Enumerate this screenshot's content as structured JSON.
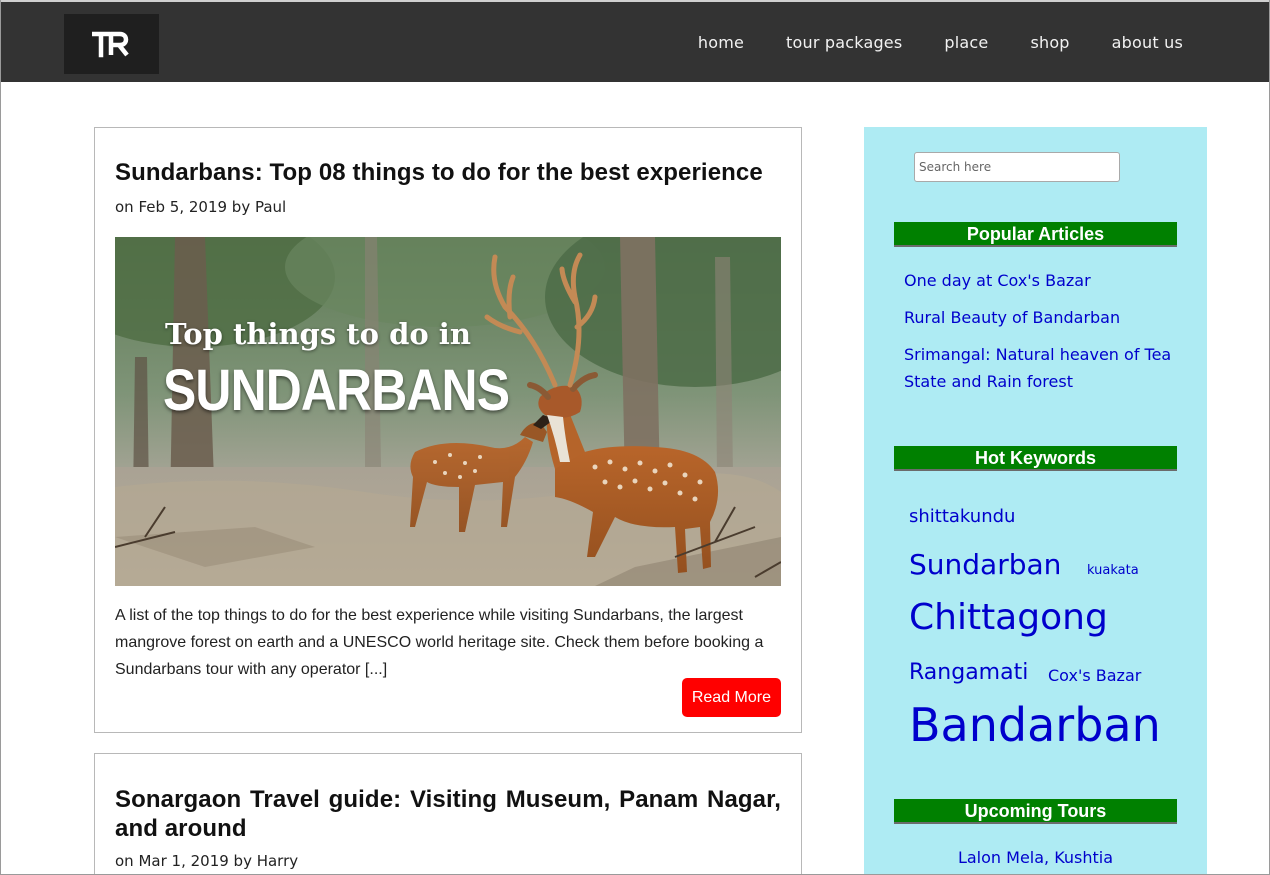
{
  "header": {
    "logo_text": "TR",
    "nav": [
      "home",
      "tour packages",
      "place",
      "shop",
      "about us"
    ]
  },
  "posts": [
    {
      "title": "Sundarbans: Top 08 things to do for the best experience",
      "meta": "on Feb 5, 2019 by Paul",
      "image_caption_line1": "Top things to do in",
      "image_caption_line2": "SUNDARBANS",
      "excerpt": "A list of the top things to do for the best experience while visiting Sundarbans, the largest mangrove forest on earth and a UNESCO world heritage site. Check them before booking a Sundarbans tour with any operator [...]",
      "read_more": "Read More"
    },
    {
      "title": "Sonargaon Travel guide: Visiting Museum, Panam Nagar, and around",
      "meta": "on Mar 1, 2019 by Harry"
    }
  ],
  "sidebar": {
    "search_placeholder": "Search here",
    "popular_title": "Popular Articles",
    "popular_articles": [
      "One day at Cox's Bazar",
      "Rural Beauty of Bandarban",
      "Srimangal: Natural heaven of Tea State and Rain forest"
    ],
    "keywords_title": "Hot Keywords",
    "keywords": [
      "shittakundu",
      "Sundarban",
      "kuakata",
      "Chittagong",
      "Rangamati",
      "Cox's Bazar",
      "Bandarban"
    ],
    "upcoming_title": "Upcoming Tours",
    "upcoming": [
      "Lalon Mela, Kushtia"
    ]
  },
  "colors": {
    "header_bg": "#333333",
    "sidebar_bg": "#aeebf3",
    "widget_title_bg": "#008000",
    "link": "#0000cc",
    "read_more_bg": "#ff0000"
  }
}
